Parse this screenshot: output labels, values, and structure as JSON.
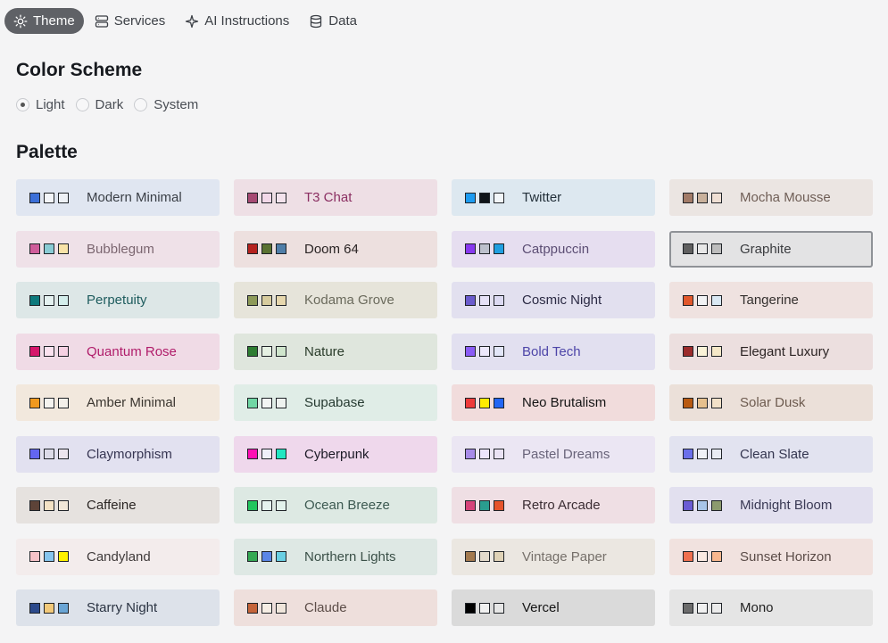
{
  "tabs": [
    {
      "label": "Theme",
      "icon": "sun-icon",
      "active": true
    },
    {
      "label": "Services",
      "icon": "server-icon",
      "active": false
    },
    {
      "label": "AI Instructions",
      "icon": "sparkle-icon",
      "active": false
    },
    {
      "label": "Data",
      "icon": "database-icon",
      "active": false
    }
  ],
  "color_scheme": {
    "title": "Color Scheme",
    "options": [
      {
        "label": "Light",
        "selected": true
      },
      {
        "label": "Dark",
        "selected": false
      },
      {
        "label": "System",
        "selected": false
      }
    ]
  },
  "palette": {
    "title": "Palette",
    "items": [
      {
        "label": "Modern Minimal",
        "bg": "#e0e6f1",
        "text": "#3a3f46",
        "swatches": [
          "#3b6fd8",
          "#f3f5f9",
          "#eef1f6"
        ]
      },
      {
        "label": "T3 Chat",
        "bg": "#eedfe5",
        "text": "#8b2f62",
        "swatches": [
          "#a64a73",
          "#f2d8e8",
          "#f3e3ec"
        ]
      },
      {
        "label": "Twitter",
        "bg": "#dde8f0",
        "text": "#23303a",
        "swatches": [
          "#1d9bf0",
          "#0f1419",
          "#f2f6f9"
        ]
      },
      {
        "label": "Mocha Mousse",
        "bg": "#ebe5e2",
        "text": "#6f5e56",
        "swatches": [
          "#a27b68",
          "#c9b19c",
          "#efdfd4"
        ]
      },
      {
        "label": "Bubblegum",
        "bg": "#efe1e8",
        "text": "#7b6670",
        "swatches": [
          "#cf5c9a",
          "#89cbd4",
          "#f9e3a8"
        ]
      },
      {
        "label": "Doom 64",
        "bg": "#ede0df",
        "text": "#2a2424",
        "swatches": [
          "#b5231f",
          "#5a7232",
          "#4f7ea8"
        ]
      },
      {
        "label": "Catppuccin",
        "bg": "#e6def0",
        "text": "#5c4e74",
        "swatches": [
          "#8839ef",
          "#bcc0cc",
          "#209fe0"
        ]
      },
      {
        "label": "Graphite",
        "bg": "#e3e3e4",
        "text": "#3a3c3f",
        "swatches": [
          "#5f5f5f",
          "#e7e7e7",
          "#bdbdbd"
        ],
        "selected": true
      },
      {
        "label": "Perpetuity",
        "bg": "#dde7e7",
        "text": "#1e5c5e",
        "swatches": [
          "#0e7a7d",
          "#e4f1f0",
          "#d4eeec"
        ]
      },
      {
        "label": "Kodama Grove",
        "bg": "#e6e4da",
        "text": "#6a6a5c",
        "swatches": [
          "#8d9a59",
          "#d7cc9e",
          "#e6d7ad"
        ]
      },
      {
        "label": "Cosmic Night",
        "bg": "#e2e0ef",
        "text": "#2b2a44",
        "swatches": [
          "#6b5ccd",
          "#e6e2f7",
          "#dcdaf2"
        ]
      },
      {
        "label": "Tangerine",
        "bg": "#efe2e0",
        "text": "#34302e",
        "swatches": [
          "#e1582c",
          "#f1f2f4",
          "#d9e8f3"
        ]
      },
      {
        "label": "Quantum Rose",
        "bg": "#f0dbe6",
        "text": "#b01c6a",
        "swatches": [
          "#d6166b",
          "#fbe2ef",
          "#f6d1e3"
        ]
      },
      {
        "label": "Nature",
        "bg": "#dfe6dd",
        "text": "#2a3c2a",
        "swatches": [
          "#2e7d32",
          "#e6f1e3",
          "#cfe5cc"
        ]
      },
      {
        "label": "Bold Tech",
        "bg": "#e2e0f0",
        "text": "#4d45a8",
        "swatches": [
          "#8a5cf6",
          "#ece8fb",
          "#e2e6f8"
        ]
      },
      {
        "label": "Elegant Luxury",
        "bg": "#ecdfdf",
        "text": "#2c2424",
        "swatches": [
          "#9b2c2c",
          "#faf3d8",
          "#f5e8c8"
        ]
      },
      {
        "label": "Amber Minimal",
        "bg": "#f2e8dd",
        "text": "#3b3630",
        "swatches": [
          "#f1991f",
          "#f5f3ef",
          "#f3efe9"
        ]
      },
      {
        "label": "Supabase",
        "bg": "#e0ede7",
        "text": "#263a31",
        "swatches": [
          "#70d6a4",
          "#f2f5f3",
          "#eef2ef"
        ]
      },
      {
        "label": "Neo Brutalism",
        "bg": "#f1dcdc",
        "text": "#141414",
        "swatches": [
          "#ee3b3b",
          "#ffeb00",
          "#2266f4"
        ]
      },
      {
        "label": "Solar Dusk",
        "bg": "#ebe0d9",
        "text": "#6d5b4f",
        "swatches": [
          "#b85a12",
          "#e6c08d",
          "#f2e1c8"
        ]
      },
      {
        "label": "Claymorphism",
        "bg": "#e2e1f0",
        "text": "#363552",
        "swatches": [
          "#6366f1",
          "#dcdbe8",
          "#ece5ee"
        ]
      },
      {
        "label": "Cyberpunk",
        "bg": "#efd8ec",
        "text": "#1c1a26",
        "swatches": [
          "#ff0fb4",
          "#f0effa",
          "#21e6c1"
        ]
      },
      {
        "label": "Pastel Dreams",
        "bg": "#ebe6f3",
        "text": "#69647a",
        "swatches": [
          "#a78be8",
          "#ebe4fb",
          "#eae3f4"
        ]
      },
      {
        "label": "Clean Slate",
        "bg": "#e2e3f0",
        "text": "#343650",
        "swatches": [
          "#6b70ea",
          "#eef0f6",
          "#e9ecf3"
        ]
      },
      {
        "label": "Caffeine",
        "bg": "#e6e2df",
        "text": "#2b2624",
        "swatches": [
          "#5d4338",
          "#f3e2c5",
          "#f1e7d8"
        ]
      },
      {
        "label": "Ocean Breeze",
        "bg": "#dde9e3",
        "text": "#3d5a52",
        "swatches": [
          "#22c55e",
          "#e5f2ef",
          "#e3f2ec"
        ]
      },
      {
        "label": "Retro Arcade",
        "bg": "#efdfe4",
        "text": "#3b2d33",
        "swatches": [
          "#d6437a",
          "#2a9d8f",
          "#e5532b"
        ]
      },
      {
        "label": "Midnight Bloom",
        "bg": "#e2e0ef",
        "text": "#3a3a55",
        "swatches": [
          "#6a5cd4",
          "#a8c5e9",
          "#8c9a6e"
        ]
      },
      {
        "label": "Candyland",
        "bg": "#f3ecec",
        "text": "#3f3a3a",
        "swatches": [
          "#f7c3c9",
          "#86c5ee",
          "#fff200"
        ]
      },
      {
        "label": "Northern Lights",
        "bg": "#dee8e4",
        "text": "#3b5048",
        "swatches": [
          "#34a853",
          "#5a86e6",
          "#69cfe3"
        ]
      },
      {
        "label": "Vintage Paper",
        "bg": "#ebe7e1",
        "text": "#76706a",
        "swatches": [
          "#a37a4f",
          "#e3dacb",
          "#e0d3b7"
        ]
      },
      {
        "label": "Sunset Horizon",
        "bg": "#f1e2df",
        "text": "#5b4c48",
        "swatches": [
          "#f0704f",
          "#fbeae2",
          "#f9b78e"
        ]
      },
      {
        "label": "Starry Night",
        "bg": "#dde2ea",
        "text": "#2a3342",
        "swatches": [
          "#2c4a8c",
          "#f2c97a",
          "#6aa5d5"
        ]
      },
      {
        "label": "Claude",
        "bg": "#eedfdc",
        "text": "#5c4d48",
        "swatches": [
          "#c5643a",
          "#f6ede4",
          "#efe5db"
        ]
      },
      {
        "label": "Vercel",
        "bg": "#dadada",
        "text": "#141414",
        "swatches": [
          "#000000",
          "#f0f0f0",
          "#e6e6e6"
        ]
      },
      {
        "label": "Mono",
        "bg": "#e5e5e5",
        "text": "#222222",
        "swatches": [
          "#6b6b6b",
          "#f0f0f0",
          "#ebebeb"
        ]
      }
    ]
  }
}
